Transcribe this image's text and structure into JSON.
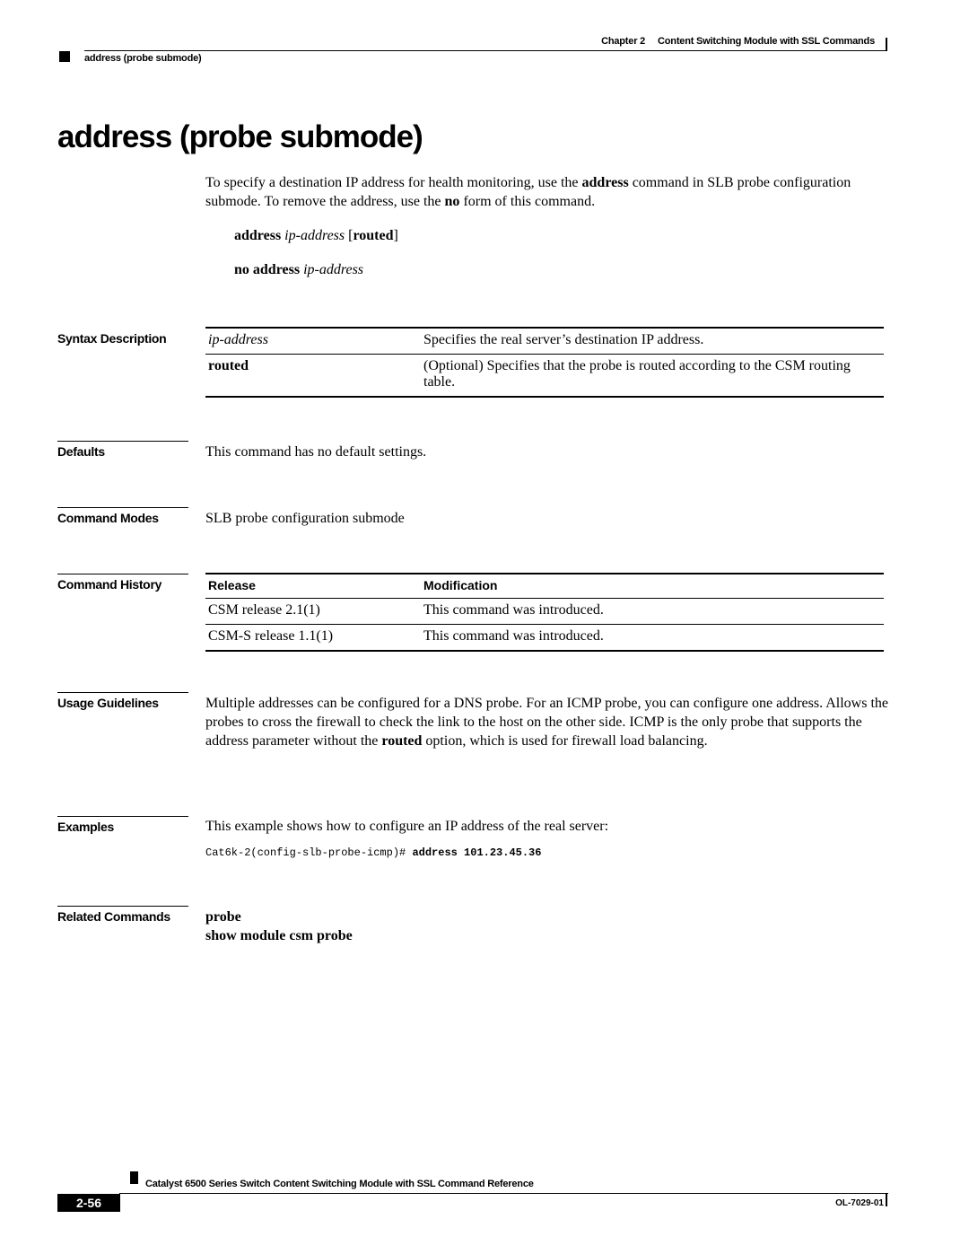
{
  "header": {
    "chapter": "Chapter 2",
    "chapter_title": "Content Switching Module with SSL Commands",
    "running_head": "address (probe submode)"
  },
  "title": "address (probe submode)",
  "intro": {
    "p1": "To specify a destination IP address for health monitoring, use the ",
    "b1": "address",
    "p2": " command in SLB probe configuration submode. To remove the address, use the ",
    "b2": "no",
    "p3": " form of this command."
  },
  "syntax": {
    "line1_cmd": "address",
    "line1_arg": "ip-address",
    "line1_opt_open": "[",
    "line1_opt": "routed",
    "line1_opt_close": "]",
    "line2_cmd": "no address",
    "line2_arg": "ip-address"
  },
  "sections": {
    "syntax_description": "Syntax Description",
    "defaults": "Defaults",
    "command_modes": "Command Modes",
    "command_history": "Command History",
    "usage_guidelines": "Usage Guidelines",
    "examples": "Examples",
    "related_commands": "Related Commands"
  },
  "syntax_table": [
    {
      "term": "ip-address",
      "desc": "Specifies the real server’s destination IP address."
    },
    {
      "term": "routed",
      "desc": "(Optional) Specifies that the probe is routed according to the CSM routing table."
    }
  ],
  "defaults_text": "This command has no default settings.",
  "command_modes_text": "SLB probe configuration submode",
  "history": {
    "headers": [
      "Release",
      "Modification"
    ],
    "rows": [
      [
        "CSM release 2.1(1)",
        "This command was introduced."
      ],
      [
        "CSM-S release 1.1(1)",
        "This command was introduced."
      ]
    ]
  },
  "usage": {
    "p1": "Multiple addresses can be configured for a DNS probe. For an ICMP probe, you can configure one address. Allows the probes to cross the firewall to check the link to the host on the other side. ICMP is the only probe that supports the address parameter without the ",
    "b1": "routed",
    "p2": " option, which is used for firewall load balancing."
  },
  "examples": {
    "text": "This example shows how to configure an IP address of the real server:",
    "prompt": "Cat6k-2(config-slb-probe-icmp)# ",
    "command": "address 101.23.45.36"
  },
  "related": [
    "probe",
    "show module csm probe"
  ],
  "footer": {
    "book_title": "Catalyst 6500 Series Switch Content Switching Module with SSL Command Reference",
    "page": "2-56",
    "doc_number": "OL-7029-01"
  }
}
